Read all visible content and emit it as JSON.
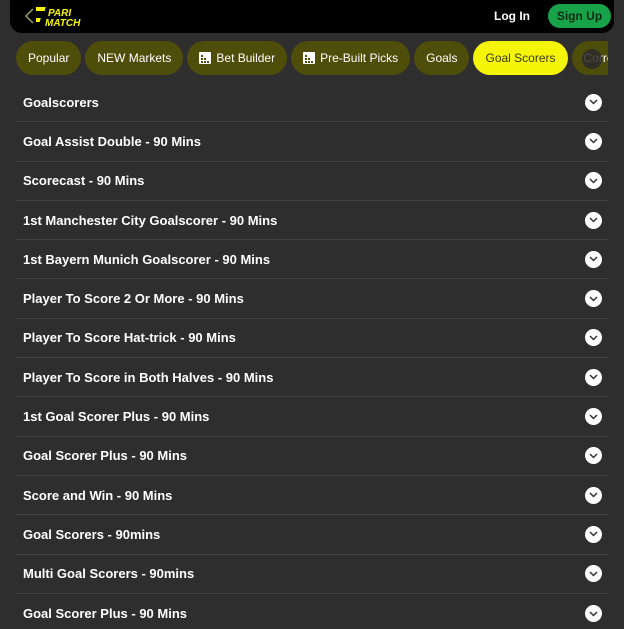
{
  "header": {
    "brand_line1": "PARI",
    "brand_line2": "MATCH",
    "login_label": "Log In",
    "signup_label": "Sign Up",
    "brand_color": "#f5f50a",
    "signup_color": "#18a34a"
  },
  "tabs": [
    {
      "label": "Popular",
      "icon": null,
      "active": false
    },
    {
      "label": "NEW Markets",
      "icon": null,
      "active": false
    },
    {
      "label": "Bet Builder",
      "icon": "bet-builder-icon",
      "active": false
    },
    {
      "label": "Pre-Built Picks",
      "icon": "bet-builder-icon",
      "active": false
    },
    {
      "label": "Goals",
      "icon": null,
      "active": false
    },
    {
      "label": "Goal Scorers",
      "icon": null,
      "active": true
    },
    {
      "label": "Correct Score",
      "icon": null,
      "active": false
    }
  ],
  "markets": [
    {
      "label": "Goalscorers"
    },
    {
      "label": "Goal Assist Double - 90 Mins"
    },
    {
      "label": "Scorecast - 90 Mins"
    },
    {
      "label": "1st Manchester City Goalscorer - 90 Mins"
    },
    {
      "label": "1st Bayern Munich Goalscorer - 90 Mins"
    },
    {
      "label": "Player To Score 2 Or More - 90 Mins"
    },
    {
      "label": "Player To Score Hat-trick - 90 Mins"
    },
    {
      "label": "Player To Score in Both Halves - 90 Mins"
    },
    {
      "label": "1st Goal Scorer Plus - 90 Mins"
    },
    {
      "label": "Goal Scorer Plus - 90 Mins"
    },
    {
      "label": "Score and Win - 90 Mins"
    },
    {
      "label": "Goal Scorers - 90mins"
    },
    {
      "label": "Multi Goal Scorers - 90mins"
    },
    {
      "label": "Goal Scorer Plus - 90 Mins"
    }
  ]
}
